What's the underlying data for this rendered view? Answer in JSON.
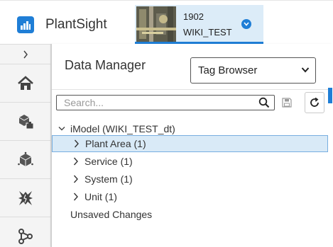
{
  "header": {
    "app_name": "PlantSight",
    "project_code": "1902",
    "project_name": "WIKI_TEST"
  },
  "nav": {
    "items": [
      {
        "icon": "home-icon"
      },
      {
        "icon": "components-icon"
      },
      {
        "icon": "3d-model-icon"
      },
      {
        "icon": "breach-icon"
      },
      {
        "icon": "network-icon"
      }
    ]
  },
  "panel": {
    "title": "Data Manager",
    "browser_select": "Tag Browser",
    "search_placeholder": "Search...",
    "tree": {
      "root": "iModel (WIKI_TEST_dt)",
      "children": [
        {
          "label": "Plant Area (1)",
          "selected": true
        },
        {
          "label": "Service (1)",
          "selected": false
        },
        {
          "label": "System (1)",
          "selected": false
        },
        {
          "label": "Unit (1)",
          "selected": false
        }
      ],
      "footer": "Unsaved Changes"
    }
  },
  "colors": {
    "accent": "#1f7ed6",
    "selected_row": "#d9eaf7",
    "project_bg": "#dcecf8"
  }
}
